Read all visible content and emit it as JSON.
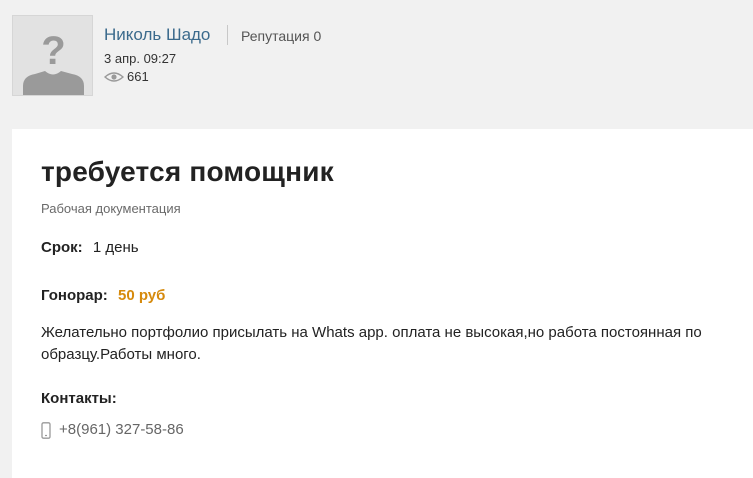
{
  "author": {
    "name": "Николь Шадо",
    "reputation": "Репутация 0",
    "date": "3 апр. 09:27",
    "views": "661",
    "avatar_icon": "user-placeholder-icon",
    "views_icon": "eye-icon"
  },
  "post": {
    "title": "требуется помощник",
    "category": "Рабочая документация",
    "term_label": "Срок:",
    "term_value": "1 день",
    "fee_label": "Гонорар:",
    "fee_value": "50 руб",
    "description": "Желательно портфолио присылать на Whats app. оплата не высокая,но работа постоянная по образцу.Работы много.",
    "contacts_label": "Контакты:",
    "phone": "+8(961) 327-58-86",
    "phone_icon": "phone-icon"
  },
  "colors": {
    "link": "#3b6a8c",
    "fee": "#d68a0c",
    "background": "#f1f1f1"
  }
}
